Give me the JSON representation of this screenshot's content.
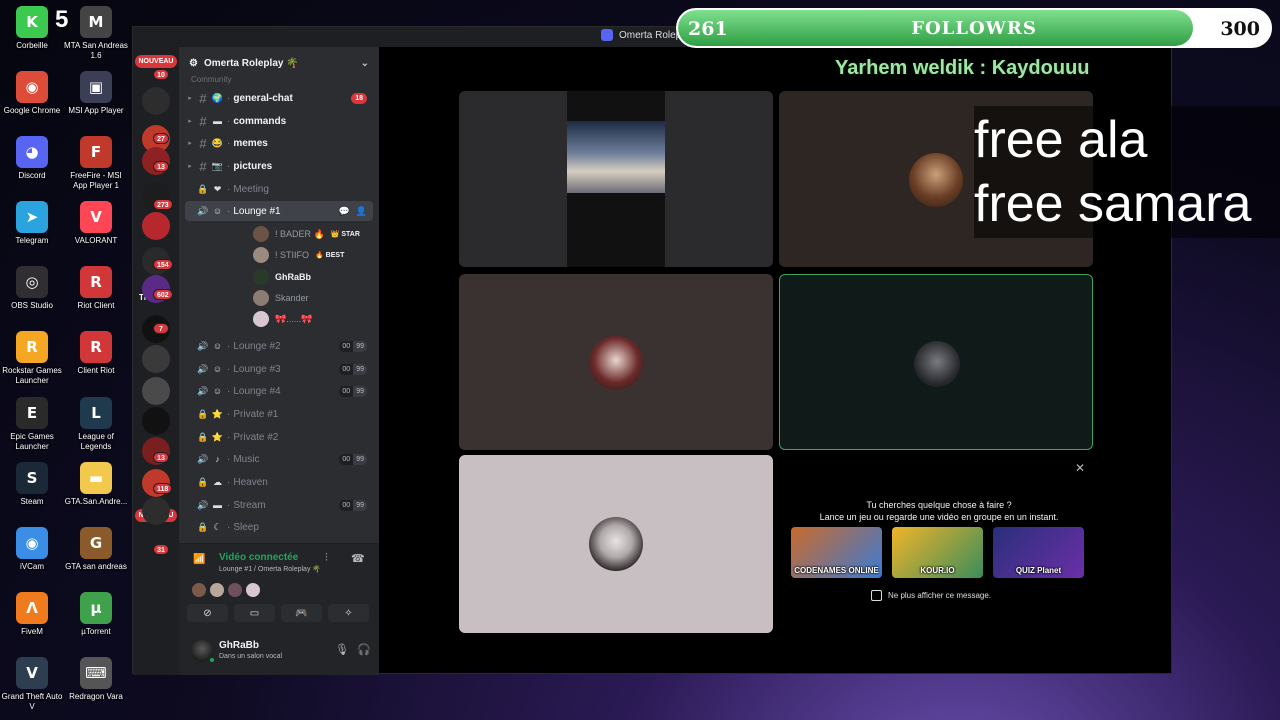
{
  "desktop": {
    "logo_count": "5",
    "icons": [
      {
        "label": "Corbeille",
        "glyph": "K",
        "color": "#3cc94f",
        "icon": "recycle-bin-icon"
      },
      {
        "label": "MTA San Andreas 1.6",
        "glyph": "M",
        "color": "#444444",
        "icon": "mta-icon"
      },
      {
        "label": "Google Chrome",
        "glyph": "◉",
        "color": "#dd4b39",
        "icon": "chrome-icon"
      },
      {
        "label": "MSI App Player",
        "glyph": "▣",
        "color": "#3a3f55",
        "icon": "msi-player-icon"
      },
      {
        "label": "Discord",
        "glyph": "◕",
        "color": "#5865f2",
        "icon": "discord-icon"
      },
      {
        "label": "FreeFire - MSI App Player 1",
        "glyph": "F",
        "color": "#c0392b",
        "icon": "freefire-icon"
      },
      {
        "label": "Telegram",
        "glyph": "➤",
        "color": "#2aa3df",
        "icon": "telegram-icon"
      },
      {
        "label": "VALORANT",
        "glyph": "V",
        "color": "#ff4655",
        "icon": "valorant-icon"
      },
      {
        "label": "OBS Studio",
        "glyph": "◎",
        "color": "#302e31",
        "icon": "obs-icon"
      },
      {
        "label": "Riot Client",
        "glyph": "R",
        "color": "#d13639",
        "icon": "riot-client-icon"
      },
      {
        "label": "Rockstar Games Launcher",
        "glyph": "R",
        "color": "#f5a623",
        "icon": "rockstar-icon"
      },
      {
        "label": "Client Riot",
        "glyph": "R",
        "color": "#d13639",
        "icon": "riot-client-icon"
      },
      {
        "label": "Epic Games Launcher",
        "glyph": "E",
        "color": "#2a2a2a",
        "icon": "epic-games-icon"
      },
      {
        "label": "League of Legends",
        "glyph": "L",
        "color": "#1e3a4c",
        "icon": "league-icon"
      },
      {
        "label": "Steam",
        "glyph": "S",
        "color": "#1b2838",
        "icon": "steam-icon"
      },
      {
        "label": "GTA.San.Andre...",
        "glyph": "▬",
        "color": "#f2c94c",
        "icon": "folder-icon"
      },
      {
        "label": "iVCam",
        "glyph": "◉",
        "color": "#3a8ee6",
        "icon": "ivcam-icon"
      },
      {
        "label": "GTA san andreas",
        "glyph": "G",
        "color": "#8a5a2b",
        "icon": "gta-sa-icon"
      },
      {
        "label": "FiveM",
        "glyph": "Λ",
        "color": "#f07b1f",
        "icon": "fivem-icon"
      },
      {
        "label": "µTorrent",
        "glyph": "µ",
        "color": "#3fa14a",
        "icon": "utorrent-icon"
      },
      {
        "label": "Grand Theft Auto V",
        "glyph": "V",
        "color": "#2c3e50",
        "icon": "gta-v-icon"
      },
      {
        "label": "Redragon Vara",
        "glyph": "⌨",
        "color": "#555555",
        "icon": "keyboard-icon"
      }
    ]
  },
  "window": {
    "title": "Omerta Roleplay"
  },
  "servers": {
    "badges": [
      "10",
      "27",
      "13",
      "273",
      "154",
      "602",
      "7",
      "13",
      "118",
      "31"
    ],
    "nouveau_label": "NOUVEAU",
    "tnl_label": "TNLOB"
  },
  "guild": {
    "name": "Omerta Roleplay 🌴",
    "category_cut": "Community"
  },
  "channels": [
    {
      "type": "text",
      "emoji": "🌍",
      "name": "general-chat",
      "unread": true,
      "ping": "18"
    },
    {
      "type": "text",
      "emoji": "▬",
      "name": "commands",
      "unread": true
    },
    {
      "type": "text",
      "emoji": "😂",
      "name": "memes",
      "unread": true
    },
    {
      "type": "text",
      "emoji": "📷",
      "name": "pictures",
      "unread": true
    },
    {
      "type": "locked",
      "emoji": "❤",
      "name": "Meeting"
    },
    {
      "type": "voice",
      "emoji": "☺",
      "name": "Lounge #1",
      "active": true
    },
    {
      "type": "voice",
      "emoji": "☺",
      "name": "Lounge #2",
      "count": [
        "00",
        "99"
      ]
    },
    {
      "type": "voice",
      "emoji": "☺",
      "name": "Lounge #3",
      "count": [
        "00",
        "99"
      ]
    },
    {
      "type": "voice",
      "emoji": "☺",
      "name": "Lounge #4",
      "count": [
        "00",
        "99"
      ]
    },
    {
      "type": "locked",
      "emoji": "⭐",
      "name": "Private #1"
    },
    {
      "type": "locked",
      "emoji": "⭐",
      "name": "Private #2"
    },
    {
      "type": "voice",
      "emoji": "♪",
      "name": "Music",
      "count": [
        "00",
        "99"
      ]
    },
    {
      "type": "locked",
      "emoji": "☁",
      "name": "Heaven"
    },
    {
      "type": "voice",
      "emoji": "▬",
      "name": "Stream",
      "count": [
        "00",
        "99"
      ]
    },
    {
      "type": "locked",
      "emoji": "☾",
      "name": "Sleep"
    }
  ],
  "voice_members": [
    {
      "name": "! BADER 🔥",
      "tag": "👑 STAR"
    },
    {
      "name": "! STIIFO",
      "tag": "🔥 BEST"
    },
    {
      "name": "GhRaBb",
      "bold": true
    },
    {
      "name": "Skander",
      "camera": true
    },
    {
      "name": "🎀......🎀"
    }
  ],
  "voice_panel": {
    "status": "Vidéo connectée",
    "location": "Lounge #1 / Omerta Roleplay 🌴"
  },
  "user": {
    "name": "GhRaBb",
    "status": "Dans un salon vocal"
  },
  "activity": {
    "line1": "Tu cherches quelque chose à faire ?",
    "line2": "Lance un jeu ou regarde une vidéo en groupe en un instant.",
    "cards": [
      "CODENAMES ONLINE",
      "KOUR.IO",
      "QUIZ Planet"
    ],
    "checkbox_label": "Ne plus afficher ce message."
  },
  "overlay": {
    "followers_current": "261",
    "followers_label": "FOLLOWRS",
    "followers_goal": "300",
    "followers_progress": 0.87,
    "shoutout": "Yarhem weldik : Kaydouuu",
    "free_line1": "free ala",
    "free_line2": "free samara"
  },
  "colors": {
    "accent_green": "#23a559",
    "ping_red": "#da373c",
    "blurple": "#5865f2",
    "speaking_border": "#3ba55d"
  }
}
